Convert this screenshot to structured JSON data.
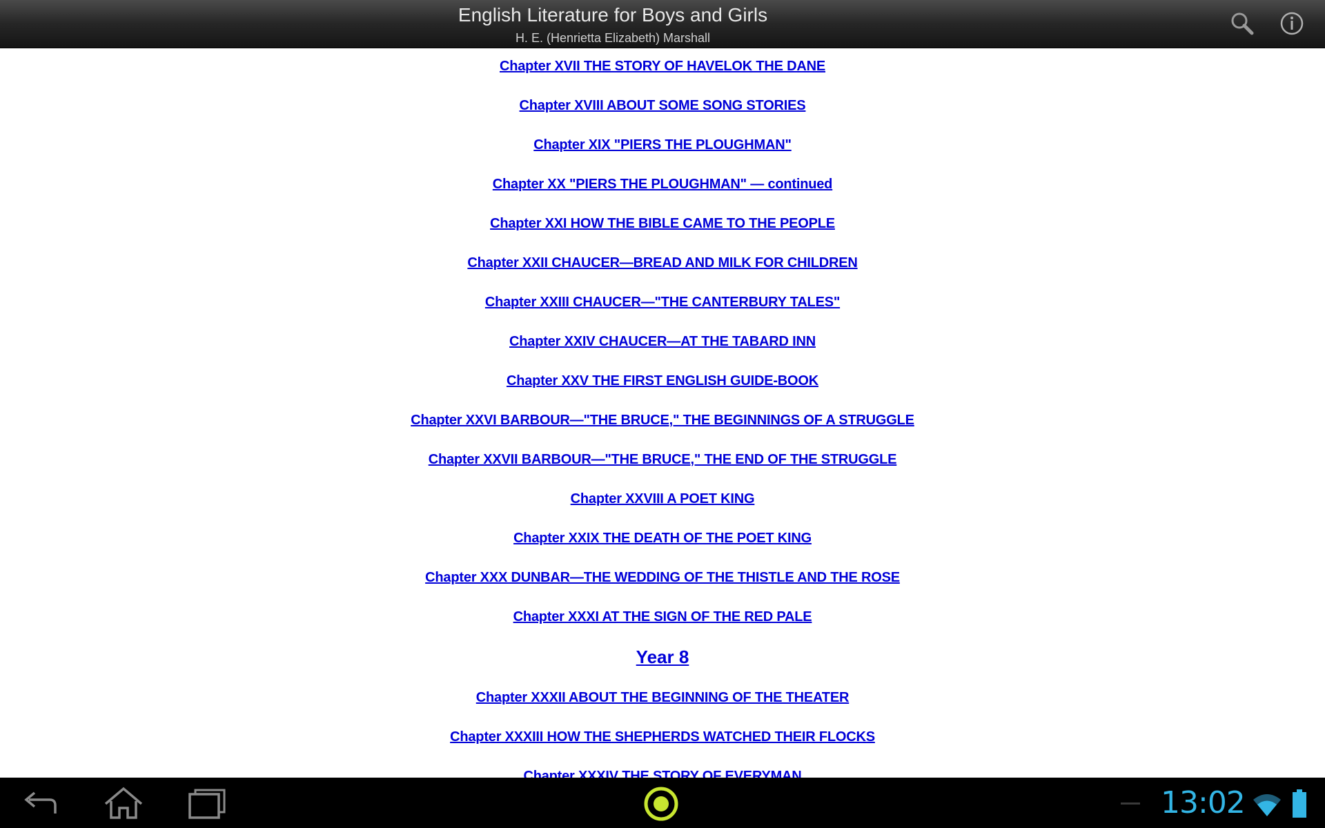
{
  "action_bar": {
    "title": "English Literature for Boys and Girls",
    "subtitle": "H. E. (Henrietta Elizabeth) Marshall",
    "icons": [
      "search-icon",
      "info-icon"
    ]
  },
  "toc": {
    "items": [
      "Chapter XVII THE STORY OF HAVELOK THE DANE",
      "Chapter XVIII ABOUT SOME SONG STORIES",
      "Chapter XIX \"PIERS THE PLOUGHMAN\"",
      "Chapter XX \"PIERS THE PLOUGHMAN\" — continued",
      "Chapter XXI HOW THE BIBLE CAME TO THE PEOPLE",
      "Chapter XXII CHAUCER—BREAD AND MILK FOR CHILDREN",
      "Chapter XXIII CHAUCER—\"THE CANTERBURY TALES\"",
      "Chapter XXIV CHAUCER—AT THE TABARD INN",
      "Chapter XXV THE FIRST ENGLISH GUIDE-BOOK",
      "Chapter XXVI BARBOUR—\"THE BRUCE,\" THE BEGINNINGS OF A STRUGGLE",
      "Chapter XXVII BARBOUR—\"THE BRUCE,\" THE END OF THE STRUGGLE",
      "Chapter XXVIII A POET KING",
      "Chapter XXIX THE DEATH OF THE POET KING",
      "Chapter XXX DUNBAR—THE WEDDING OF THE THISTLE AND THE ROSE",
      "Chapter XXXI AT THE SIGN OF THE RED PALE"
    ],
    "section_heading": "Year 8",
    "items_after": [
      "Chapter XXXII ABOUT THE BEGINNING OF THE THEATER",
      "Chapter XXXIII HOW THE SHEPHERDS WATCHED THEIR FLOCKS",
      "Chapter XXXIV THE STORY OF EVERYMAN"
    ]
  },
  "system_bar": {
    "clock": "13:02",
    "accent_color": "#33b5e5",
    "icons": [
      "back-icon",
      "home-icon",
      "recent-apps-icon",
      "app-launcher-icon",
      "wifi-icon",
      "battery-icon"
    ]
  }
}
